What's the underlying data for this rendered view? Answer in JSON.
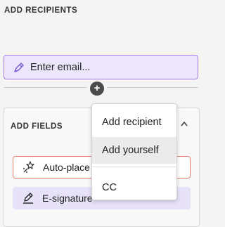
{
  "recipients": {
    "section_title": "ADD RECIPIENTS",
    "email_placeholder": "Enter email...",
    "add_icon": "plus-circle-icon"
  },
  "fields": {
    "section_title": "ADD FIELDS",
    "items": [
      {
        "label": "Auto-place",
        "icon": "auto-place-icon"
      },
      {
        "label": "E-signature",
        "icon": "signature-icon"
      }
    ]
  },
  "menu": {
    "items": [
      {
        "label": "Add recipient"
      },
      {
        "label": "Add yourself"
      },
      {
        "label": "CC"
      }
    ]
  },
  "colors": {
    "accent": "#9f7ee5",
    "email_bg": "#ece6fb",
    "auto_place_border": "#e37e6e"
  }
}
